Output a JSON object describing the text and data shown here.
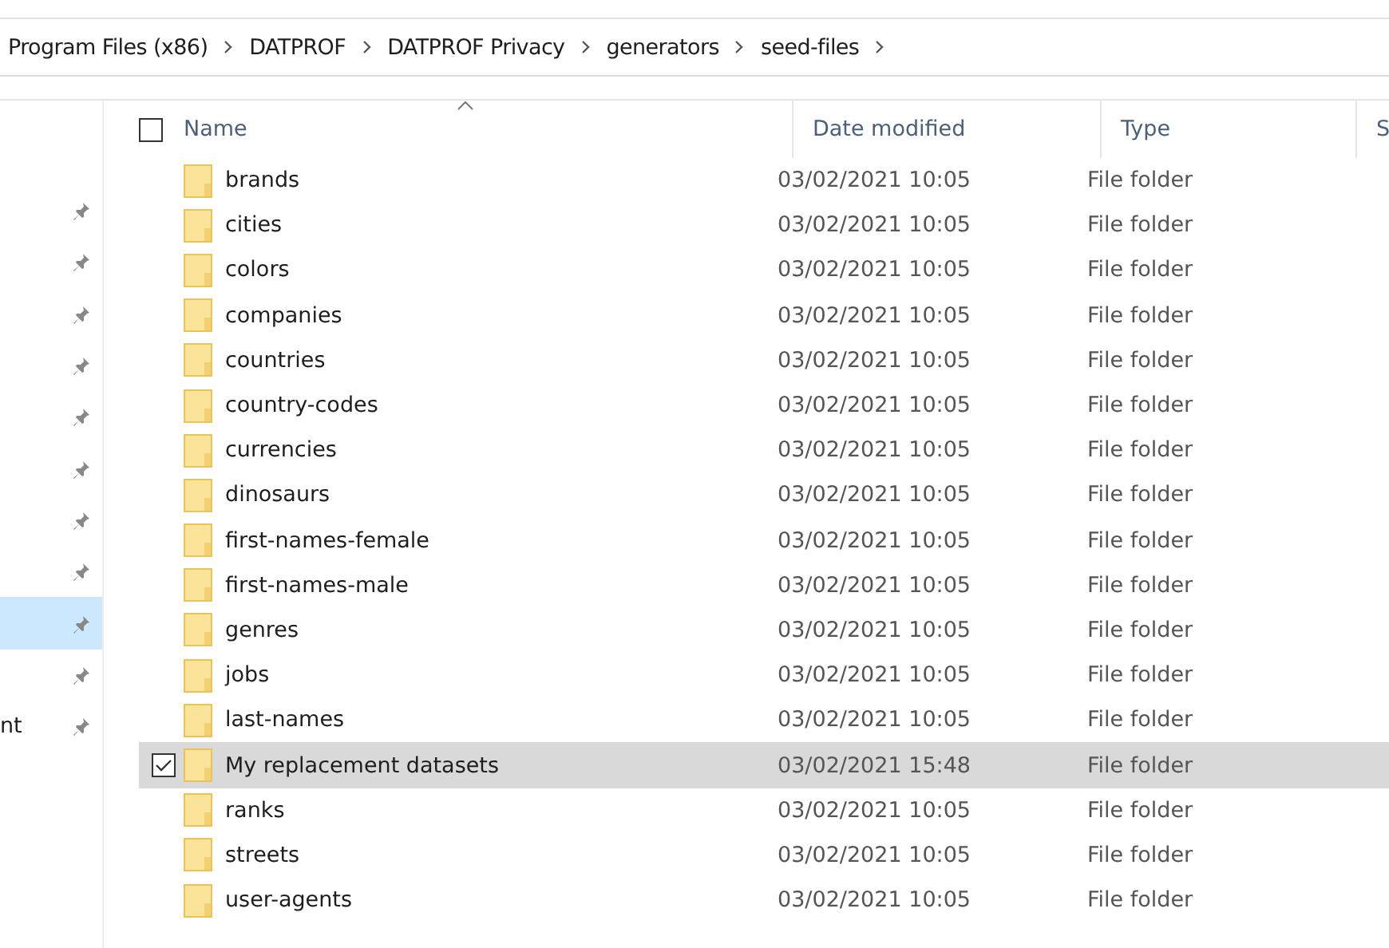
{
  "breadcrumb": [
    "Program Files (x86)",
    "DATPROF",
    "DATPROF Privacy",
    "generators",
    "seed-files"
  ],
  "sidebar": {
    "items": [
      {
        "pinned": true,
        "selected": false
      },
      {
        "pinned": true,
        "selected": false
      },
      {
        "pinned": true,
        "selected": false
      },
      {
        "pinned": true,
        "selected": false
      },
      {
        "pinned": true,
        "selected": false
      },
      {
        "pinned": true,
        "selected": false
      },
      {
        "pinned": true,
        "selected": false
      },
      {
        "pinned": true,
        "selected": false
      },
      {
        "pinned": true,
        "selected": true
      },
      {
        "pinned": true,
        "selected": false
      },
      {
        "label": "nt",
        "pinned": true,
        "selected": false
      }
    ]
  },
  "table": {
    "select_all": {
      "checked": false
    },
    "columns": [
      "Name",
      "Date modified",
      "Type",
      "S"
    ],
    "rows": [
      {
        "name": "brands",
        "date": "03/02/2021 10:05",
        "type": "File folder",
        "selected": false
      },
      {
        "name": "cities",
        "date": "03/02/2021 10:05",
        "type": "File folder",
        "selected": false
      },
      {
        "name": "colors",
        "date": "03/02/2021 10:05",
        "type": "File folder",
        "selected": false
      },
      {
        "name": "companies",
        "date": "03/02/2021 10:05",
        "type": "File folder",
        "selected": false
      },
      {
        "name": "countries",
        "date": "03/02/2021 10:05",
        "type": "File folder",
        "selected": false
      },
      {
        "name": "country-codes",
        "date": "03/02/2021 10:05",
        "type": "File folder",
        "selected": false
      },
      {
        "name": "currencies",
        "date": "03/02/2021 10:05",
        "type": "File folder",
        "selected": false
      },
      {
        "name": "dinosaurs",
        "date": "03/02/2021 10:05",
        "type": "File folder",
        "selected": false
      },
      {
        "name": "first-names-female",
        "date": "03/02/2021 10:05",
        "type": "File folder",
        "selected": false
      },
      {
        "name": "first-names-male",
        "date": "03/02/2021 10:05",
        "type": "File folder",
        "selected": false
      },
      {
        "name": "genres",
        "date": "03/02/2021 10:05",
        "type": "File folder",
        "selected": false
      },
      {
        "name": "jobs",
        "date": "03/02/2021 10:05",
        "type": "File folder",
        "selected": false
      },
      {
        "name": "last-names",
        "date": "03/02/2021 10:05",
        "type": "File folder",
        "selected": false
      },
      {
        "name": "My replacement datasets",
        "date": "03/02/2021 15:48",
        "type": "File folder",
        "selected": true
      },
      {
        "name": "ranks",
        "date": "03/02/2021 10:05",
        "type": "File folder",
        "selected": false
      },
      {
        "name": "streets",
        "date": "03/02/2021 10:05",
        "type": "File folder",
        "selected": false
      },
      {
        "name": "user-agents",
        "date": "03/02/2021 10:05",
        "type": "File folder",
        "selected": false
      }
    ]
  }
}
